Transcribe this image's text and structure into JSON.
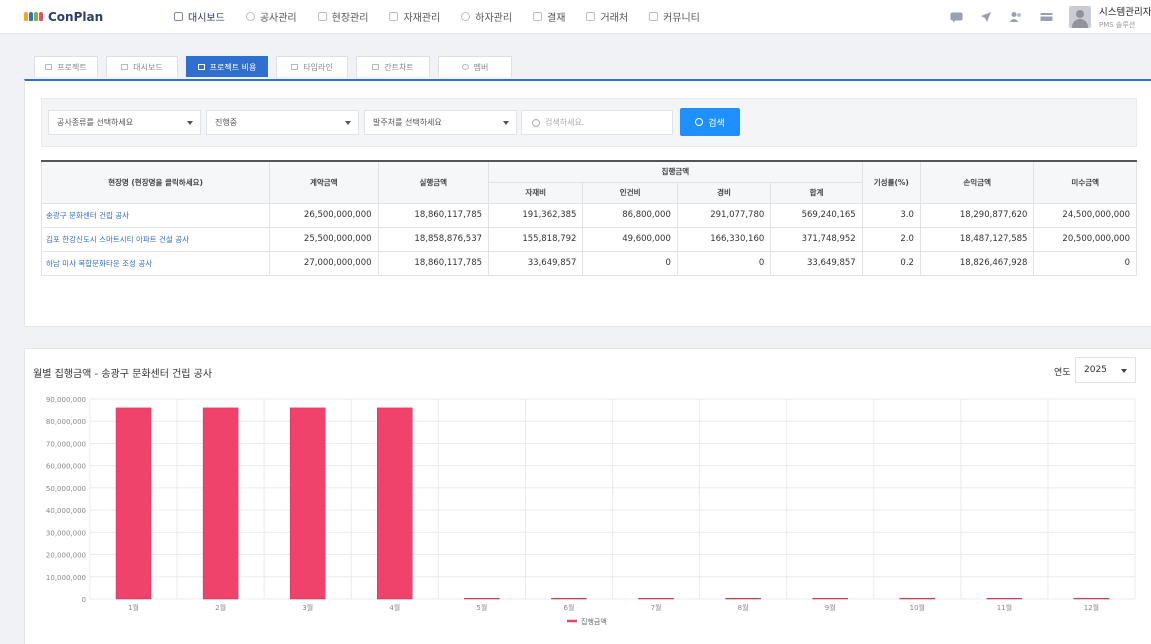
{
  "app": {
    "logo_text": "ConPlan",
    "logo_colors": [
      "#f5a623",
      "#2f6fd0",
      "#7cb342",
      "#e94f64"
    ]
  },
  "menu": [
    {
      "label": "대시보드",
      "icon": "chart-icon",
      "active": true
    },
    {
      "label": "공사관리",
      "icon": "circle-icon"
    },
    {
      "label": "현장관리",
      "icon": "building-icon"
    },
    {
      "label": "자재관리",
      "icon": "box-icon"
    },
    {
      "label": "하자관리",
      "icon": "warning-icon"
    },
    {
      "label": "결재",
      "icon": "pen-icon"
    },
    {
      "label": "거래처",
      "icon": "handshake-icon"
    },
    {
      "label": "커뮤니티",
      "icon": "chat-icon"
    }
  ],
  "user": {
    "name": "시스템관리자",
    "role": "PMS 솔루션"
  },
  "tabs": [
    {
      "label": "프로젝트",
      "active": false
    },
    {
      "label": "대시보드",
      "active": false
    },
    {
      "label": "프로젝트 비용",
      "active": true
    },
    {
      "label": "타임라인",
      "active": false
    },
    {
      "label": "간트차트",
      "active": false
    },
    {
      "label": "멤버",
      "active": false
    }
  ],
  "filters": {
    "type_select": "공사종류를 선택하세요",
    "status_select": "진행중",
    "client_select": "발주처를 선택하세요",
    "search_placeholder": "검색하세요.",
    "search_button": "검색"
  },
  "table": {
    "headers": {
      "site": "현장명 (현장명을 클릭하세요)",
      "contract": "계약금액",
      "budget": "실행금액",
      "exec_group": "집행금액",
      "material": "자재비",
      "labor": "인건비",
      "expense": "경비",
      "total": "합계",
      "progress": "기성률(%)",
      "profit": "손익금액",
      "receivable": "미수금액"
    },
    "rows": [
      {
        "site": "송광구 문화센터 건립 공사",
        "contract": "26,500,000,000",
        "budget": "18,860,117,785",
        "material": "191,362,385",
        "labor": "86,800,000",
        "expense": "291,077,780",
        "total": "569,240,165",
        "progress": "3.0",
        "profit": "18,290,877,620",
        "receivable": "24,500,000,000"
      },
      {
        "site": "김포 한강신도시 스마트시티 아파트 건설 공사",
        "contract": "25,500,000,000",
        "budget": "18,858,876,537",
        "material": "155,818,792",
        "labor": "49,600,000",
        "expense": "166,330,160",
        "total": "371,748,952",
        "progress": "2.0",
        "profit": "18,487,127,585",
        "receivable": "20,500,000,000"
      },
      {
        "site": "하남 미사 복합문화타운 조성 공사",
        "contract": "27,000,000,000",
        "budget": "18,860,117,785",
        "material": "33,649,857",
        "labor": "0",
        "expense": "0",
        "total": "33,649,857",
        "progress": "0.2",
        "profit": "18,826,467,928",
        "receivable": "0"
      }
    ]
  },
  "chart_section": {
    "title": "월별 집행금액 - 송광구 문화센터 건립 공사",
    "year_label": "연도",
    "year_value": "2025"
  },
  "chart_data": {
    "type": "bar",
    "categories": [
      "1월",
      "2월",
      "3월",
      "4월",
      "5월",
      "6월",
      "7월",
      "8월",
      "9월",
      "10월",
      "11월",
      "12월"
    ],
    "series": [
      {
        "name": "집행금액",
        "color": "#f0436b",
        "values": [
          86000000,
          86000000,
          86000000,
          86000000,
          0,
          0,
          0,
          0,
          0,
          0,
          0,
          0
        ]
      }
    ],
    "yticks": [
      "0",
      "10,000,000",
      "20,000,000",
      "30,000,000",
      "40,000,000",
      "50,000,000",
      "60,000,000",
      "70,000,000",
      "80,000,000",
      "90,000,000"
    ],
    "ylim": [
      0,
      90000000
    ],
    "grid": true,
    "legend": "bottom-center"
  }
}
